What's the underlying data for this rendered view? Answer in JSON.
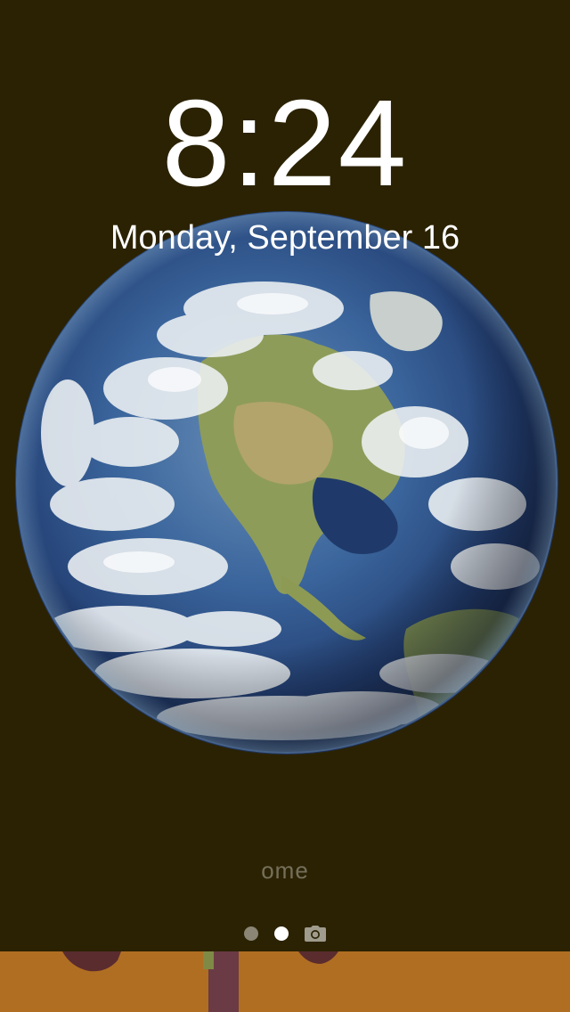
{
  "lockscreen": {
    "time": "8:24",
    "date": "Monday, September 16",
    "unlock_hint": "ome",
    "wallpaper": "earth-globe",
    "colors": {
      "background": "#2b2203",
      "bottom_strip": "#b06e22",
      "ocean": "#2e5a96",
      "land": "#8c9a55",
      "cloud": "#eef2f4"
    },
    "pager": {
      "pages": 2,
      "active_index": 1,
      "trailing_icon": "camera-icon"
    }
  }
}
